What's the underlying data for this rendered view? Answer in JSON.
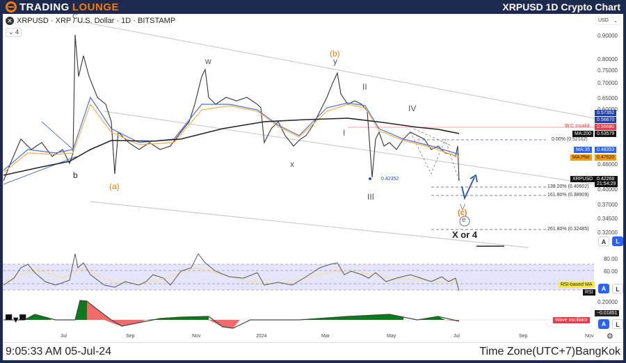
{
  "header": {
    "brand_part1": "TradingLounge",
    "brand_part2": "Lounge",
    "title": "XRPUSD 1D Crypto Chart"
  },
  "symbol": {
    "pair": "XRPUSD · XRP / U.S. Dollar · 1D · BITSTAMP",
    "indicators_collapsed": "4",
    "currency": "USD"
  },
  "price_axis": [
    "0.90000",
    "0.80000",
    "0.75000",
    "0.70000",
    "0.65000",
    "0.60000",
    "0.46000",
    "0.40000",
    "0.37000",
    "0.34500",
    "0.32000"
  ],
  "tags": {
    "p1": "0.57352",
    "p2": "0.56670",
    "wc_label": "W.C.Invalid",
    "wc_value": "0.55680",
    "ma200_label": "MA:200",
    "ma200_value": "0.53579",
    "ma35_label": "MA:35",
    "ma35_value": "0.48353",
    "maplot_label": "MA:Plot",
    "maplot_value": "0.47620",
    "sym_label": "XRPUSD",
    "last_price": "0.42268",
    "countdown": "21:54:29"
  },
  "fib": {
    "f0": "0.00% (0.52102)",
    "f1382": "138.20% (0.40602)",
    "f1618": "161.80% (0.38909)",
    "f2618": "261.80% (0.32485)"
  },
  "waves": {
    "C": "C",
    "w": "w",
    "b_paren": "(b)",
    "y": "y",
    "II": "II",
    "IV": "IV",
    "I": "I",
    "x": "x",
    "b": "b",
    "a_paren": "(a)",
    "III": "III",
    "low": "0.42352",
    "V": "V",
    "c_paren": "(c)",
    "e": "e",
    "x_or_4": "X or 4"
  },
  "rsi": {
    "l80": "80.00",
    "l60": "60.00",
    "ma_tag": "RSI-based MA",
    "tag": "RSI"
  },
  "osc": {
    "l02": "0.20000",
    "value": "−0.01851",
    "tag": "Wave oscillator"
  },
  "buttons": {
    "auto": "A",
    "log": "L"
  },
  "time_axis": [
    "Jul",
    "Sep",
    "Nov",
    "2024",
    "Mar",
    "May",
    "Jul",
    "Sep",
    "Nov"
  ],
  "footer": {
    "datetime": "9:05:33 AM 05-Jul-24",
    "timezone": "Time Zone(UTC+7)BangKok"
  },
  "colors": {
    "navy": "#1b2a4e",
    "orange": "#f57c00",
    "blue": "#2962ff",
    "red": "#f23645"
  }
}
